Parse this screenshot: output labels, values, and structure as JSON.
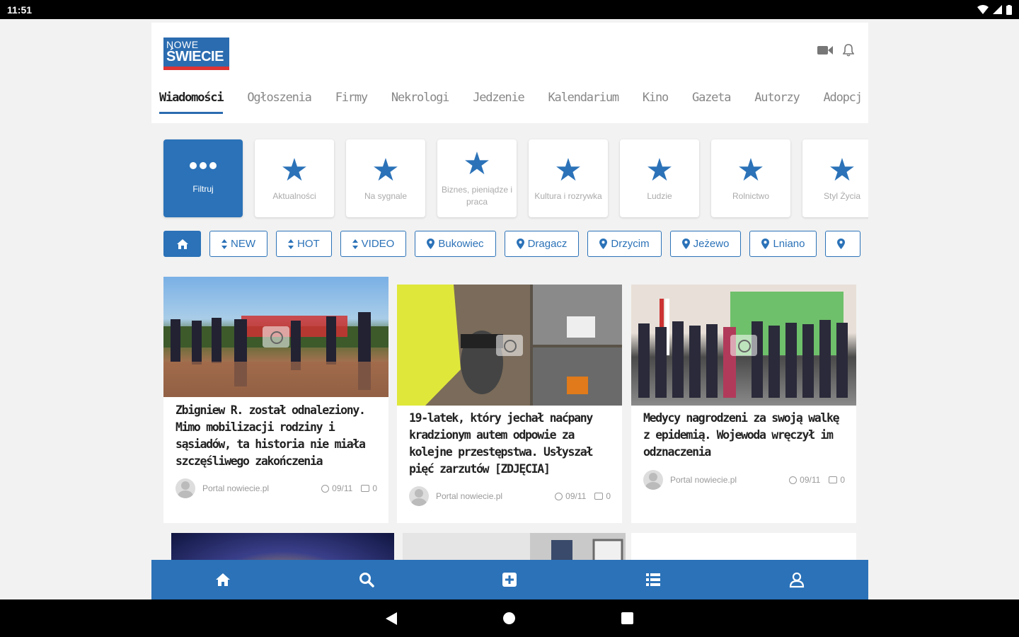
{
  "status": {
    "time": "11:51"
  },
  "logo": {
    "line1": "NOWE",
    "line2": "ŚWIECIE"
  },
  "tabs": [
    {
      "label": "Wiadomości",
      "active": true
    },
    {
      "label": "Ogłoszenia"
    },
    {
      "label": "Firmy"
    },
    {
      "label": "Nekrologi"
    },
    {
      "label": "Jedzenie"
    },
    {
      "label": "Kalendarium"
    },
    {
      "label": "Kino"
    },
    {
      "label": "Gazeta"
    },
    {
      "label": "Autorzy"
    },
    {
      "label": "Adopcj"
    }
  ],
  "categories": [
    {
      "label": "Filtruj",
      "icon": "dots-icon",
      "active": true
    },
    {
      "label": "Aktualności",
      "icon": "star-icon"
    },
    {
      "label": "Na sygnale",
      "icon": "star-icon"
    },
    {
      "label": "Biznes, pieniądze i praca",
      "icon": "star-icon"
    },
    {
      "label": "Kultura i rozrywka",
      "icon": "star-icon"
    },
    {
      "label": "Ludzie",
      "icon": "star-icon"
    },
    {
      "label": "Rolnictwo",
      "icon": "star-icon"
    },
    {
      "label": "Styl Życia",
      "icon": "star-icon"
    }
  ],
  "chips": [
    {
      "label": "",
      "icon": "home-icon"
    },
    {
      "label": "NEW",
      "icon": "sort-icon"
    },
    {
      "label": "HOT",
      "icon": "sort-icon"
    },
    {
      "label": "VIDEO",
      "icon": "sort-icon"
    },
    {
      "label": "Bukowiec",
      "icon": "pin-icon"
    },
    {
      "label": "Dragacz",
      "icon": "pin-icon"
    },
    {
      "label": "Drzycim",
      "icon": "pin-icon"
    },
    {
      "label": "Jeżewo",
      "icon": "pin-icon"
    },
    {
      "label": "Lniano",
      "icon": "pin-icon"
    },
    {
      "label": "",
      "icon": "pin-icon"
    }
  ],
  "articles": [
    {
      "title": "Zbigniew R. został odnaleziony. Mimo mobilizacji rodziny i sąsiadów, ta historia nie miała szczęśliwego zakończenia",
      "author": "Portal nowiecie.pl",
      "date": "09/11",
      "comments": "0"
    },
    {
      "title": "19-latek, który jechał naćpany kradzionym autem odpowie za kolejne przestępstwa. Usłyszał pięć zarzutów [ZDJĘCIA]",
      "author": "Portal nowiecie.pl",
      "date": "09/11",
      "comments": "0"
    },
    {
      "title": "Medycy nagrodzeni za swoją walkę z epidemią. Wojewoda wręczył im odznaczenia",
      "author": "Portal nowiecie.pl",
      "date": "09/11",
      "comments": "0"
    }
  ],
  "colors": {
    "accent": "#2b72b8",
    "logo_stripe": "#dd3333"
  }
}
